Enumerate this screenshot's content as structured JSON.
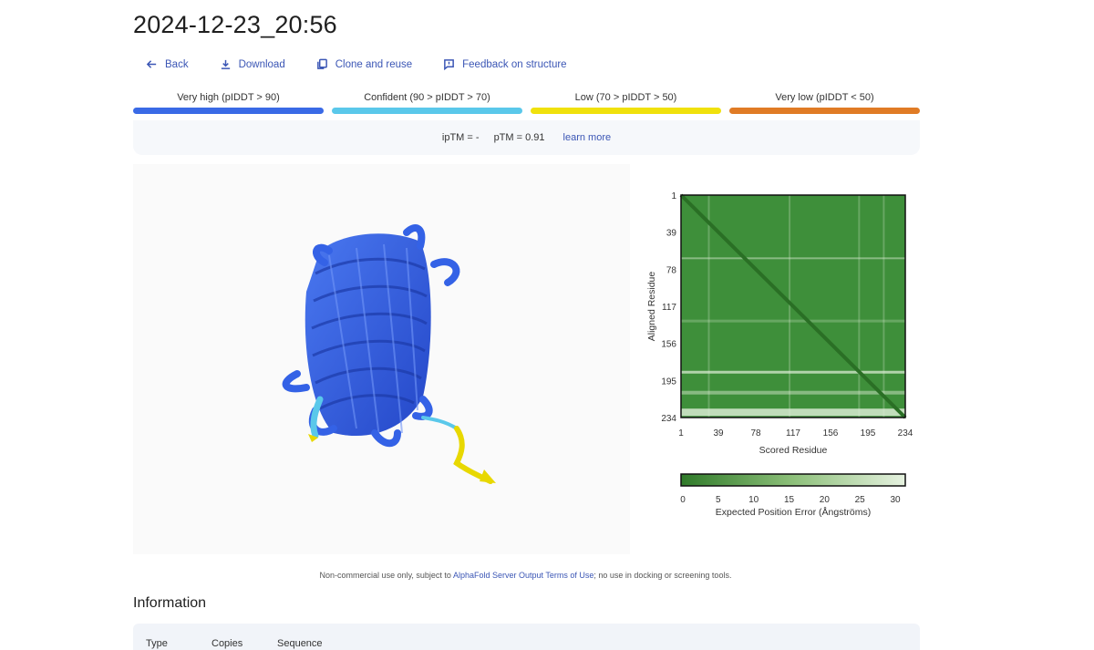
{
  "page": {
    "title": "2024-12-23_20:56"
  },
  "actions": [
    {
      "label": "Back",
      "icon": "arrow-left-icon"
    },
    {
      "label": "Download",
      "icon": "download-icon"
    },
    {
      "label": "Clone and reuse",
      "icon": "copy-icon"
    },
    {
      "label": "Feedback on structure",
      "icon": "feedback-icon"
    }
  ],
  "confidence_legend": [
    {
      "label": "Very high (pIDDT > 90)",
      "color": "#3a6ae6"
    },
    {
      "label": "Confident (90 > pIDDT > 70)",
      "color": "#5ac8ea"
    },
    {
      "label": "Low (70 > pIDDT > 50)",
      "color": "#f0e10c"
    },
    {
      "label": "Very low (pIDDT < 50)",
      "color": "#e07b25"
    }
  ],
  "scores": {
    "iptm": "ipTM = -",
    "ptm": "pTM = 0.91",
    "learn_more": "learn more"
  },
  "pae_plot": {
    "y_label": "Aligned Residue",
    "x_label": "Scored Residue",
    "ticks": [
      "1",
      "39",
      "78",
      "117",
      "156",
      "195",
      "234"
    ],
    "colorbar_ticks": [
      "0",
      "5",
      "10",
      "15",
      "20",
      "25",
      "30"
    ],
    "colorbar_label": "Expected Position Error (Ångströms)",
    "base_color": "#3e8f3a",
    "light_color": "#e2f0dc"
  },
  "footer": {
    "prefix": "Non-commercial use only, subject to ",
    "link": "AlphaFold Server Output Terms of Use",
    "suffix": "; no use in docking or screening tools."
  },
  "information": {
    "title": "Information",
    "columns": [
      "Type",
      "Copies",
      "Sequence"
    ]
  }
}
